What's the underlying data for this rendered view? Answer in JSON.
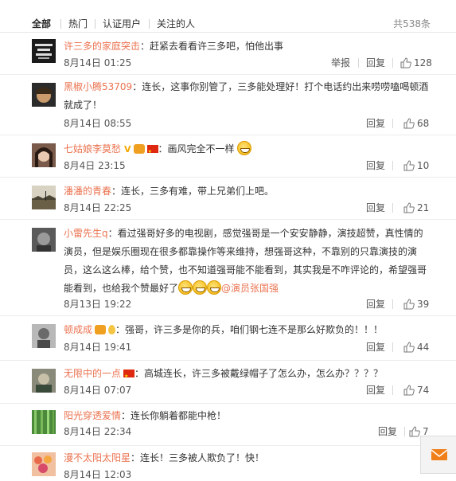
{
  "tabs": [
    "全部",
    "热门",
    "认证用户",
    "关注的人"
  ],
  "total": "共538条",
  "actions": {
    "report": "举报",
    "reply": "回复"
  },
  "comments": [
    {
      "user": "许三多的家庭突击",
      "colon": "：",
      "text": "赶紧去看看许三多吧，怕他出事",
      "time": "8月14日 01:25",
      "likes": "128",
      "avatar_text": "BASKETBALL IS MY GIRLFRIEND"
    },
    {
      "user": "黑椒小腾53709",
      "colon": "：",
      "text": "连长，这事你别管了，三多能处理好！打个电话约出来唠唠嗑喝顿酒就成了！",
      "time": "8月14日 08:55",
      "likes": "68"
    },
    {
      "user": "七姑娘李莫愁",
      "colon": "：",
      "text": "画风完全不一样",
      "time": "8月4日 23:15",
      "likes": "10"
    },
    {
      "user": "潘潘的青春",
      "colon": "：",
      "text": "连长，三多有难，带上兄弟们上吧。",
      "time": "8月14日 22:25",
      "likes": "21"
    },
    {
      "user": "小雷先生q",
      "colon": "：",
      "text": "看过强哥好多的电视剧，感觉强哥是一个安安静静，演技超赞，真性情的演员，但是娱乐圈现在很多都靠操作等来维持，想强哥这种，不靠别的只靠演技的演员，这么这么棒，给个赞，也不知道强哥能不能看到，其实我是不咋评论的，希望强哥能看到，也给我个赞最好了",
      "mention": "@演员张国强",
      "time": "8月13日 19:22",
      "likes": "39"
    },
    {
      "user": "顿成成",
      "colon": "：",
      "text": "强哥，许三多是你的兵，咱们钢七连不是那么好欺负的！！！",
      "time": "8月14日 19:41",
      "likes": "44"
    },
    {
      "user": "无限中的一点",
      "colon": "：",
      "text": "高城连长，许三多被戴绿帽子了怎么办，怎么办？？？？",
      "time": "8月14日 07:07",
      "likes": "74"
    },
    {
      "user": "阳光穿透爱情",
      "colon": "：",
      "text": "连长你躺着都能中枪！",
      "time": "8月14日 22:34",
      "likes": "7"
    },
    {
      "user": "漫不太阳太阳星",
      "colon": "：",
      "text": "连长！三多被人欺负了！快！",
      "time": "8月14日 12:03",
      "likes": ""
    }
  ]
}
